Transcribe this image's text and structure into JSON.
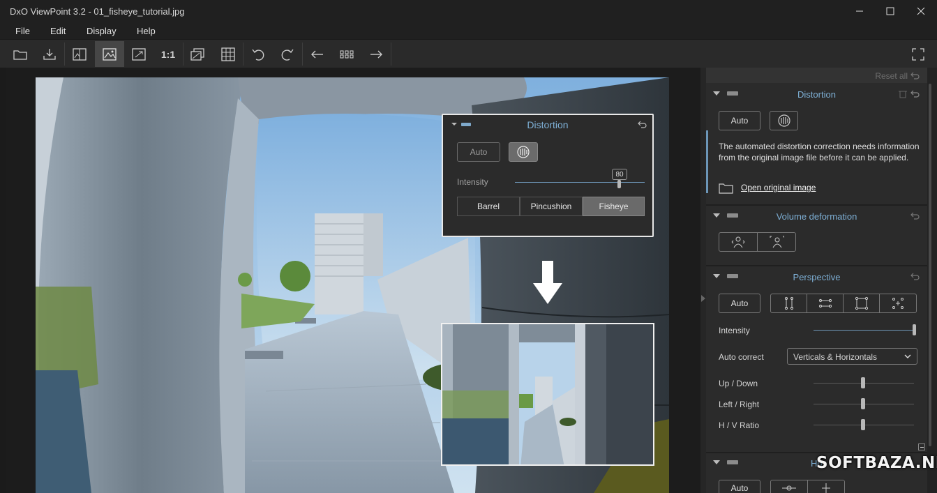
{
  "window": {
    "title": "DxO ViewPoint 3.2 - 01_fisheye_tutorial.jpg"
  },
  "menu": [
    "File",
    "Edit",
    "Display",
    "Help"
  ],
  "toolbar": {
    "one_to_one_label": "1:1",
    "icons": [
      "open-folder-icon",
      "export-icon",
      "before-after-icon",
      "image-view-icon",
      "fit-screen-icon",
      "one-to-one-icon",
      "compare-icon",
      "grid-icon",
      "rotate-left-icon",
      "rotate-right-icon",
      "previous-icon",
      "filmstrip-icon",
      "next-icon",
      "fullscreen-icon"
    ]
  },
  "inset_panel": {
    "title": "Distortion",
    "auto_label": "Auto",
    "intensity_label": "Intensity",
    "intensity_value": "80",
    "segments": [
      "Barrel",
      "Pincushion",
      "Fisheye"
    ],
    "selected_segment": "Fisheye"
  },
  "right_panel": {
    "reset_all": "Reset all",
    "distortion": {
      "title": "Distortion",
      "auto_label": "Auto",
      "info_text": "The automated distortion correction needs information from the original image file before it can be applied.",
      "open_link": "Open original image"
    },
    "volume": {
      "title": "Volume deformation"
    },
    "perspective": {
      "title": "Perspective",
      "auto_label": "Auto",
      "intensity_label": "Intensity",
      "intensity_value": 1.0,
      "auto_correct_label": "Auto correct",
      "auto_correct_value": "Verticals & Horizontals",
      "up_down_label": "Up / Down",
      "left_right_label": "Left / Right",
      "hv_ratio_label": "H / V Ratio",
      "up_down_value": 0.5,
      "left_right_value": 0.5,
      "hv_ratio_value": 0.5
    },
    "next_section_title": "Ho",
    "next_auto_label": "Auto"
  },
  "watermark": "SOFTBAZA.NET",
  "colors": {
    "accent_blue": "#7eb0d6",
    "panel_bg": "#2b2b2b",
    "canvas_bg": "#1c1c1c"
  }
}
